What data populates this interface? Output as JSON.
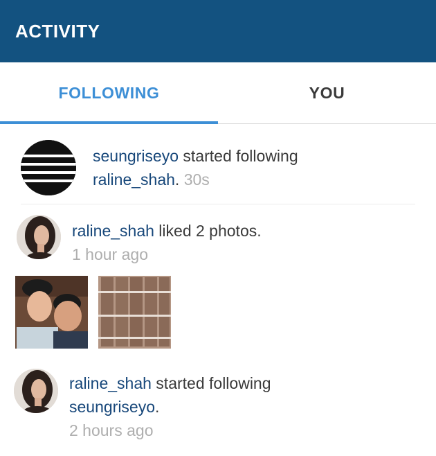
{
  "header": {
    "title": "ACTIVITY"
  },
  "tabs": [
    {
      "label": "FOLLOWING",
      "active": true
    },
    {
      "label": "YOU",
      "active": false
    }
  ],
  "accent_color": "#3d8fd6",
  "header_color": "#135280",
  "username_color": "#17477a",
  "activity": [
    {
      "user": "seungriseyo",
      "action": " started following",
      "target": "raline_shah",
      "target_suffix": ".",
      "time": "30s"
    },
    {
      "user": "raline_shah",
      "action": " liked 2 photos.",
      "time": "1 hour ago",
      "photos": [
        "two-men-selfie",
        "striped-product-columns"
      ]
    },
    {
      "user": "raline_shah",
      "action": " started following",
      "target": "seungriseyo",
      "target_suffix": ".",
      "time": "2 hours ago"
    }
  ]
}
